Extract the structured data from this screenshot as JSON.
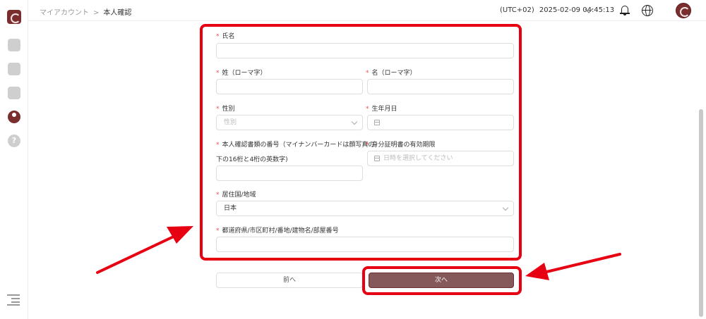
{
  "breadcrumb": {
    "parent": "マイアカウント",
    "separator": ">",
    "current": "本人確認"
  },
  "header": {
    "timezone": "(UTC+02)",
    "datetime": "2025-02-09 04:45:13"
  },
  "form": {
    "required_mark": "*",
    "full_name": {
      "label": "氏名",
      "value": ""
    },
    "last_name_roman": {
      "label": "姓（ローマ字）",
      "value": ""
    },
    "first_name_roman": {
      "label": "名（ローマ字）",
      "value": ""
    },
    "gender": {
      "label": "性別",
      "placeholder": "性別"
    },
    "birthdate": {
      "label": "生年月日",
      "value": ""
    },
    "id_number": {
      "label_line1": "本人確認書類の番号（マイナンバーカードは顔写真の",
      "label_line2": "下の16桁と4桁の英数字)",
      "value": ""
    },
    "id_expiry": {
      "label": "身分証明書の有効期限",
      "placeholder": "日時を選択してください"
    },
    "country": {
      "label": "居住国/地域",
      "value": "日本"
    },
    "address": {
      "label": "都道府県/市区町村/番地/建物名/部屋番号",
      "value": ""
    }
  },
  "buttons": {
    "prev": "前へ",
    "next": "次へ"
  },
  "colors": {
    "accent": "#7a2e2e",
    "next_button": "#85585a",
    "annotation_red": "#e60012",
    "required": "#e8534f"
  },
  "icons": {
    "sidebar": [
      "logo-icon",
      "home-icon",
      "wallet-icon",
      "box-icon",
      "user-icon",
      "help-icon",
      "collapse-menu-icon"
    ],
    "header": [
      "chevron-down-icon",
      "bell-icon",
      "globe-icon",
      "avatar"
    ]
  }
}
